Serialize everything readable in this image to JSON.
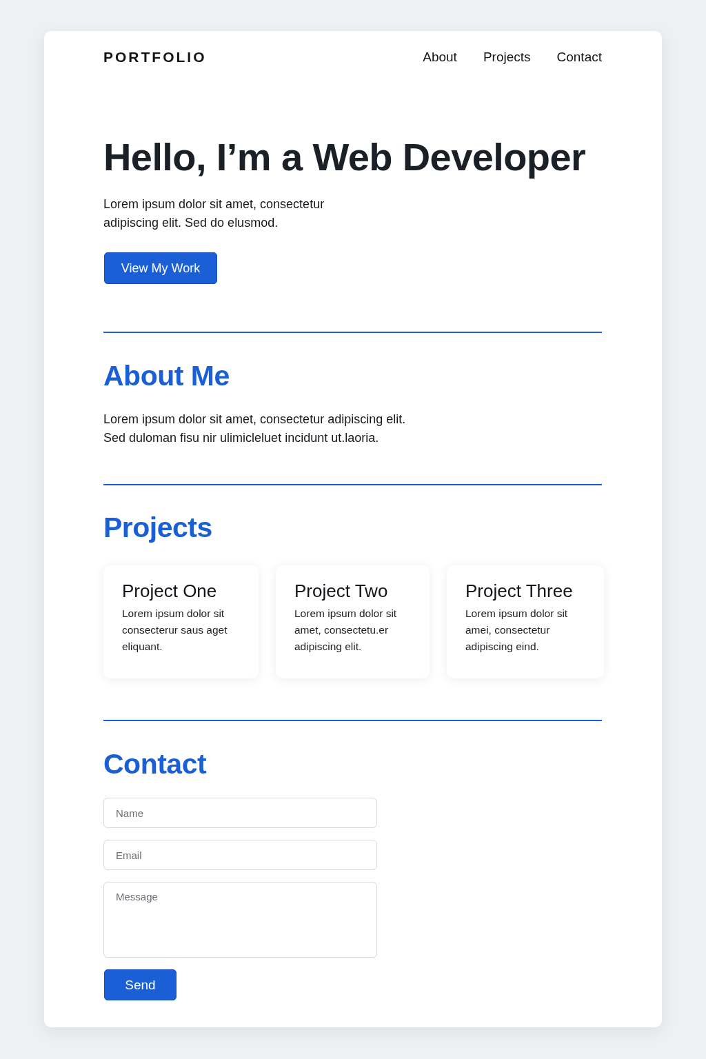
{
  "header": {
    "logo": "PORTFOLIO",
    "nav": [
      "About",
      "Projects",
      "Contact"
    ]
  },
  "hero": {
    "title": "Hello, I’m a Web Developer",
    "text": "Lorem ipsum dolor sit amet, consectetur adipiscing elit. Sed do elusmod.",
    "button": "View My Work"
  },
  "about": {
    "heading": "About Me",
    "text": "Lorem ipsum dolor sit amet, consectetur adipiscing elit. Sed duloman fisu nir ulimicleluet incidunt ut.laoria."
  },
  "projects": {
    "heading": "Projects",
    "items": [
      {
        "title": "Project One",
        "text": "Lorem ipsum dolor sit consecterur saus aget eliquant."
      },
      {
        "title": "Project Two",
        "text": "Lorem ipsum dolor sit amet, consectetu.er adipiscing elit."
      },
      {
        "title": "Project Three",
        "text": "Lorem ipsum dolor sit amei, consectetur adipiscing eind."
      }
    ]
  },
  "contact": {
    "heading": "Contact",
    "fields": [
      {
        "kind": "input",
        "placeholder": "Name"
      },
      {
        "kind": "input",
        "placeholder": "Email"
      },
      {
        "kind": "textarea",
        "placeholder": "Message"
      }
    ],
    "button": "Send"
  }
}
